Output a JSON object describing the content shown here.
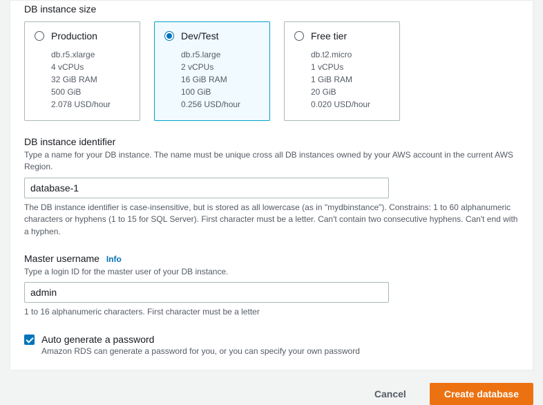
{
  "instanceSize": {
    "label": "DB instance size",
    "tiles": [
      {
        "title": "Production",
        "selected": false,
        "spec1": "db.r5.xlarge",
        "spec2": "4 vCPUs",
        "spec3": "32 GiB RAM",
        "spec4": "500 GiB",
        "spec5": "2.078 USD/hour"
      },
      {
        "title": "Dev/Test",
        "selected": true,
        "spec1": "db.r5.large",
        "spec2": "2 vCPUs",
        "spec3": "16 GiB RAM",
        "spec4": "100 GiB",
        "spec5": "0.256 USD/hour"
      },
      {
        "title": "Free tier",
        "selected": false,
        "spec1": "db.t2.micro",
        "spec2": "1 vCPUs",
        "spec3": "1 GiB RAM",
        "spec4": "20 GiB",
        "spec5": "0.020 USD/hour"
      }
    ]
  },
  "identifier": {
    "label": "DB instance identifier",
    "desc": "Type a name for your DB instance. The name must be unique cross all DB instances owned by your AWS account in the current AWS Region.",
    "value": "database-1",
    "constraint": "The DB instance identifier is case-insensitive, but is stored as all lowercase (as in \"mydbinstance\"). Constrains: 1 to 60 alphanumeric characters or hyphens (1 to 15 for SQL Server). First character must be a letter. Can't contain two consecutive hyphens. Can't end with a hyphen."
  },
  "masterUsername": {
    "label": "Master username",
    "info": "Info",
    "desc": "Type a login ID for the master user of your DB instance.",
    "value": "admin",
    "constraint": "1 to 16 alphanumeric characters. First character must be a letter"
  },
  "autoPassword": {
    "label": "Auto generate a password",
    "desc": "Amazon RDS can generate a password for you, or you can specify your own password"
  },
  "footer": {
    "cancel": "Cancel",
    "create": "Create database"
  }
}
